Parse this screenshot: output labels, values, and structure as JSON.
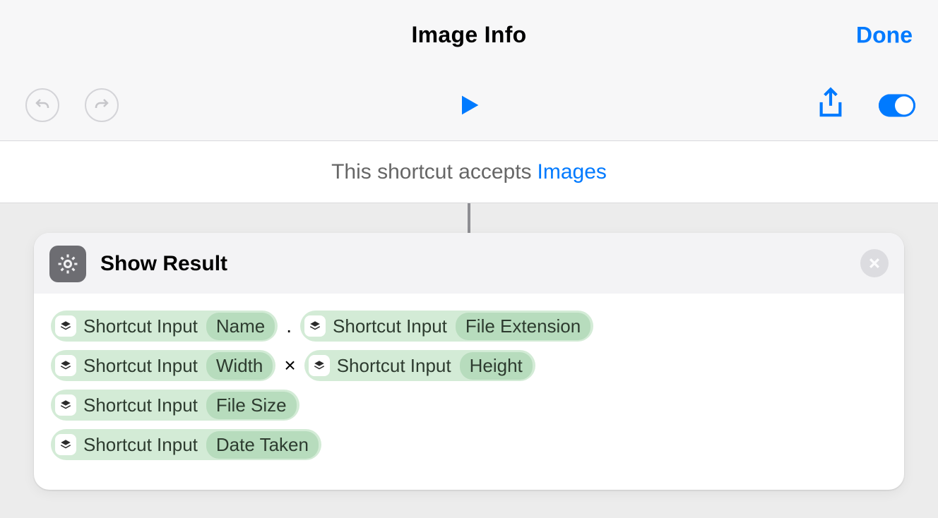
{
  "header": {
    "title": "Image Info",
    "done_label": "Done"
  },
  "accepts": {
    "prefix": "This shortcut accepts",
    "type_label": "Images"
  },
  "action": {
    "title": "Show Result",
    "rows": [
      {
        "tokens": [
          {
            "var": "Shortcut Input",
            "prop": "Name"
          },
          {
            "sep": "."
          },
          {
            "var": "Shortcut Input",
            "prop": "File Extension"
          }
        ]
      },
      {
        "tokens": [
          {
            "var": "Shortcut Input",
            "prop": "Width"
          },
          {
            "sep": "×"
          },
          {
            "var": "Shortcut Input",
            "prop": "Height"
          }
        ]
      },
      {
        "tokens": [
          {
            "var": "Shortcut Input",
            "prop": "File Size"
          }
        ]
      },
      {
        "tokens": [
          {
            "var": "Shortcut Input",
            "prop": "Date Taken"
          }
        ]
      }
    ]
  }
}
